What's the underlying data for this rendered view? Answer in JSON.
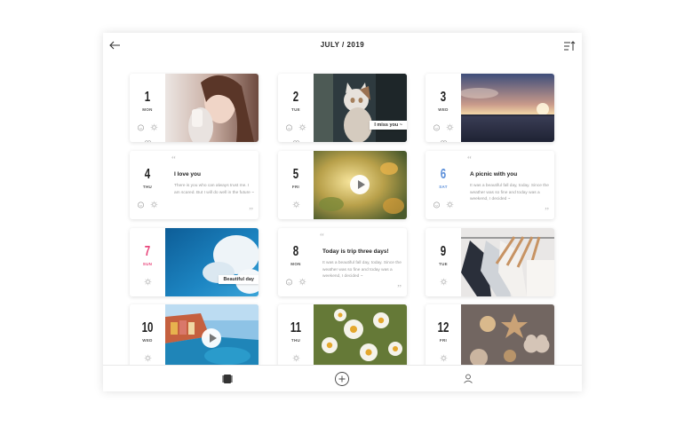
{
  "header": {
    "title": "JULY / 2019",
    "back_icon": "arrow-left-icon",
    "sort_icon": "sort-list-icon"
  },
  "days": [
    {
      "num": "1",
      "dow": "MON"
    },
    {
      "num": "2",
      "dow": "TUE"
    },
    {
      "num": "3",
      "dow": "WED"
    },
    {
      "num": "4",
      "dow": "THU"
    },
    {
      "num": "5",
      "dow": "FRI"
    },
    {
      "num": "6",
      "dow": "SAT",
      "color": "#5b8fd9"
    },
    {
      "num": "7",
      "dow": "SUN",
      "color": "#e8457a"
    },
    {
      "num": "8",
      "dow": "MON"
    },
    {
      "num": "9",
      "dow": "TUE"
    },
    {
      "num": "10",
      "dow": "WED"
    },
    {
      "num": "11",
      "dow": "THU"
    },
    {
      "num": "12",
      "dow": "FRI"
    }
  ],
  "notes": {
    "day4": {
      "title": "I love you",
      "body": "There is you who can always trust me. I am scared. But I will do well in the future ~"
    },
    "day6": {
      "title": "A picnic with you",
      "body": "It was a beautiful fall day, today. Since the weather was so fine and today was a weekend, I decided ~"
    },
    "day8": {
      "title": "Today is trip three days!",
      "body": "It was a beautiful fall day, today. Since the weather was so fine and today was a weekend, I decided ~"
    }
  },
  "captions": {
    "day2": "I miss you ~",
    "day7": "Beautiful day"
  },
  "bottom_nav": {
    "left_icon": "book-icon",
    "center_icon": "add-circle-icon",
    "right_icon": "user-icon"
  }
}
